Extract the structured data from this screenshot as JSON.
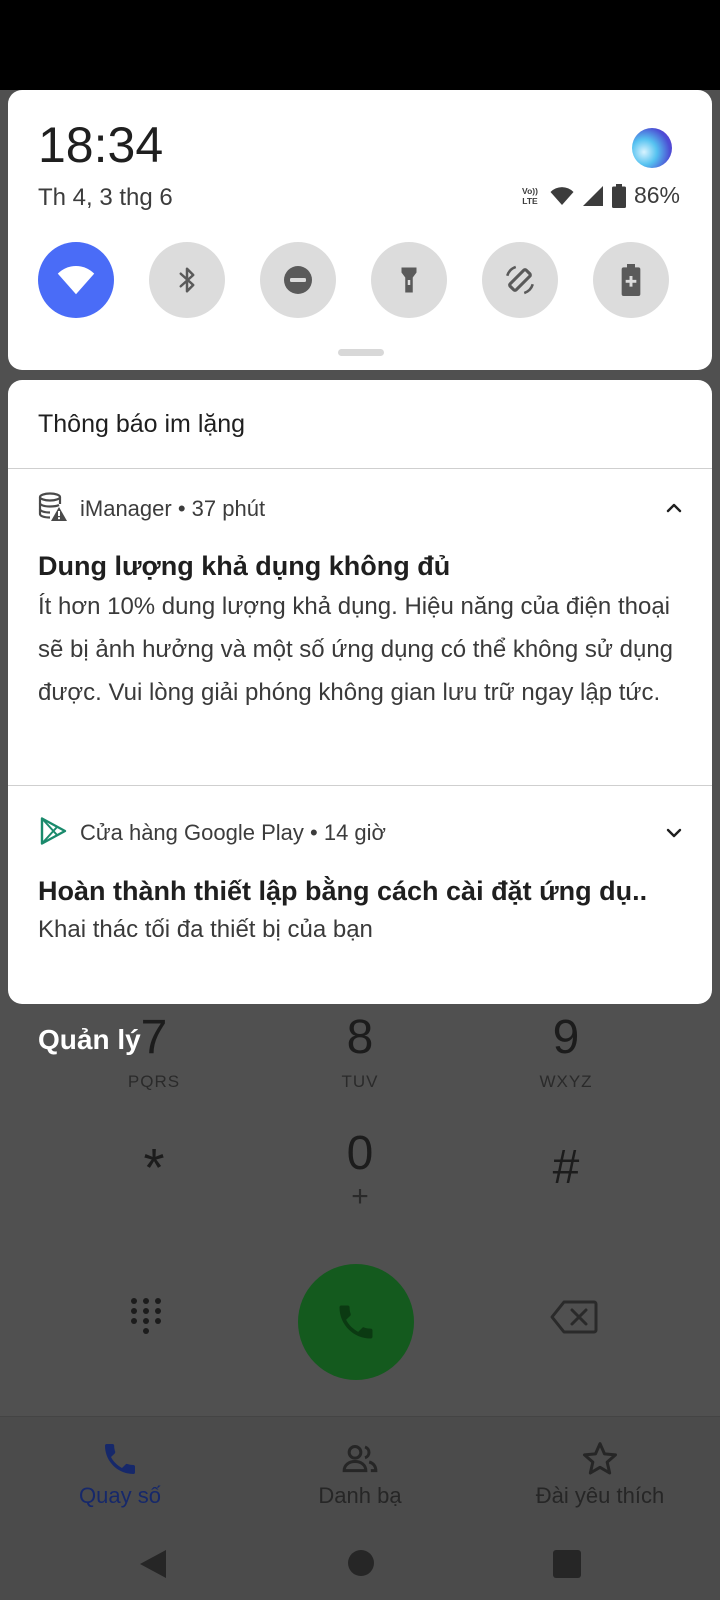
{
  "quick_settings": {
    "time": "18:34",
    "date": "Th 4, 3 thg 6",
    "battery_percent": "86%",
    "tiles": [
      {
        "name": "wifi",
        "on": true
      },
      {
        "name": "bluetooth",
        "on": false
      },
      {
        "name": "do-not-disturb",
        "on": false
      },
      {
        "name": "flashlight",
        "on": false
      },
      {
        "name": "auto-rotate",
        "on": false
      },
      {
        "name": "battery-saver",
        "on": false
      }
    ]
  },
  "notifications": {
    "section_header": "Thông báo im lặng",
    "items": [
      {
        "app": "iManager",
        "age": "37 phút",
        "title": "Dung lượng khả dụng không đủ",
        "body": "Ít hơn 10% dung lượng khả dụng. Hiệu năng của điện thoại sẽ bị ảnh hưởng và một số ứng dụng có thể không sử dụng được. Vui lòng giải phóng không gian lưu trữ ngay lập tức.",
        "expanded": true
      },
      {
        "app": "Cửa hàng Google Play",
        "age": "14 giờ",
        "title": "Hoàn thành thiết lập bằng cách cài đặt ứng dụ..",
        "body": "Khai thác tối đa thiết bị của bạn",
        "expanded": false
      }
    ]
  },
  "dialer": {
    "manage_label": "Quản lý",
    "keys": [
      {
        "digit": "7",
        "letters": "PQRS"
      },
      {
        "digit": "8",
        "letters": "TUV"
      },
      {
        "digit": "9",
        "letters": "WXYZ"
      },
      {
        "digit": "*",
        "letters": ""
      },
      {
        "digit": "0",
        "letters": "+"
      },
      {
        "digit": "#",
        "letters": ""
      }
    ],
    "nav": [
      {
        "label": "Quay số",
        "active": true
      },
      {
        "label": "Danh bạ",
        "active": false
      },
      {
        "label": "Đài yêu thích",
        "active": false
      }
    ]
  },
  "colors": {
    "accent": "#4a6cf7",
    "call_green": "#145a1e",
    "active_nav": "#16286a"
  }
}
